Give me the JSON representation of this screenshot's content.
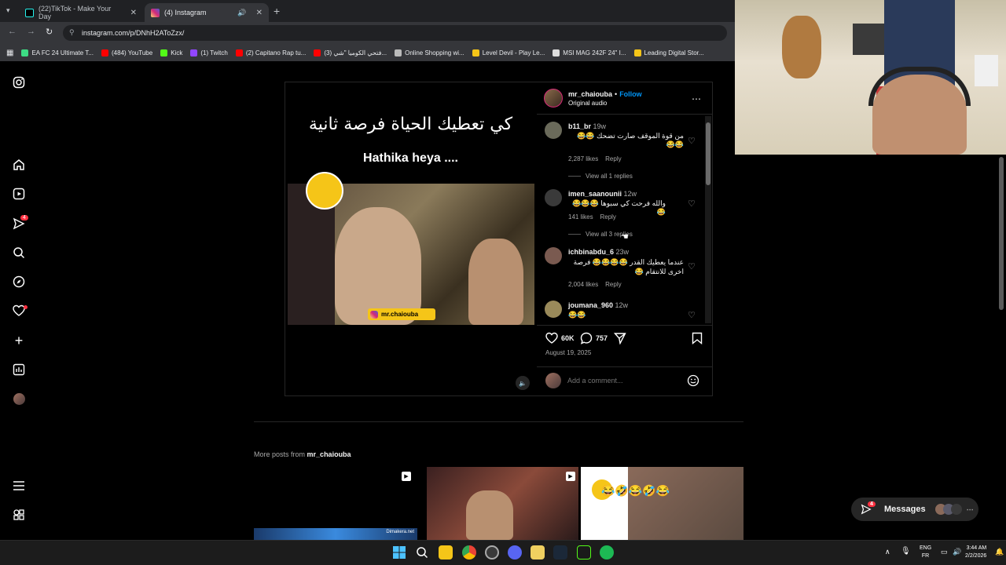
{
  "browser": {
    "tabs": [
      {
        "title": "(22)TikTok - Make Your Day",
        "active": false
      },
      {
        "title": "(4) Instagram",
        "active": true
      }
    ],
    "new_tab": "+",
    "url": "instagram.com/p/DNhH2AToZzx/",
    "bookmarks": [
      {
        "label": "EA FC 24 Ultimate T...",
        "color": "#3ddc84"
      },
      {
        "label": "(484) YouTube",
        "color": "#ff0000"
      },
      {
        "label": "Kick",
        "color": "#53fc18"
      },
      {
        "label": "(1) Twitch",
        "color": "#9146ff"
      },
      {
        "label": "(2) Capitano Rap tu...",
        "color": "#ff0000"
      },
      {
        "label": "(3) فتحي الكوميا \"شي...",
        "color": "#ff0000"
      },
      {
        "label": "Online Shopping wi...",
        "color": "#bbbbbb"
      },
      {
        "label": "Level Devil - Play Le...",
        "color": "#f5c518"
      },
      {
        "label": "MSI MAG 242F 24\" I...",
        "color": "#dddddd"
      },
      {
        "label": "Leading Digital Stor...",
        "color": "#f5c518"
      }
    ]
  },
  "sidebar": {
    "notifications_badge": "4"
  },
  "post": {
    "video_text_arabic": "كي تعطيك الحياة فرصة ثانية",
    "video_text_latin": "Hathika heya ....",
    "video_handle": "mr.chaiouba",
    "author": "mr_chaiouba",
    "dot": "•",
    "follow": "Follow",
    "audio": "Original audio",
    "comments": [
      {
        "user": "b11_br",
        "time": "19w",
        "text": "من قوة الموقف صارت تضحك 😂😂😂😂",
        "likes": "2,287 likes",
        "reply": "Reply",
        "view": "View all 1 replies"
      },
      {
        "user": "imen_saanounii",
        "time": "12w",
        "text": "والله فرحت كي سبوها 😂😂😂😂",
        "likes": "141 likes",
        "reply": "Reply",
        "view": "View all 3 replies"
      },
      {
        "user": "ichbinabdu_6",
        "time": "23w",
        "text": "عندما يعطيك القدر 😂😂😂😂 فرصة اخرى للانتقام 😂",
        "likes": "2,004 likes",
        "reply": "Reply",
        "view": ""
      },
      {
        "user": "joumana_960",
        "time": "12w",
        "text": "😂😂",
        "likes": "",
        "reply": "",
        "view": ""
      }
    ],
    "like_count": "60K",
    "comment_count": "757",
    "date": "August 19, 2025",
    "add_comment_placeholder": "Add a comment..."
  },
  "more_posts": {
    "prefix": "More posts from",
    "author": "mr_chaiouba",
    "thumb1_label": "Dimakera.net"
  },
  "messages": {
    "label": "Messages",
    "badge": "4"
  },
  "system": {
    "lang1": "ENG",
    "lang2": "FR",
    "time": "3:44 AM",
    "date": "2/2/2026"
  }
}
